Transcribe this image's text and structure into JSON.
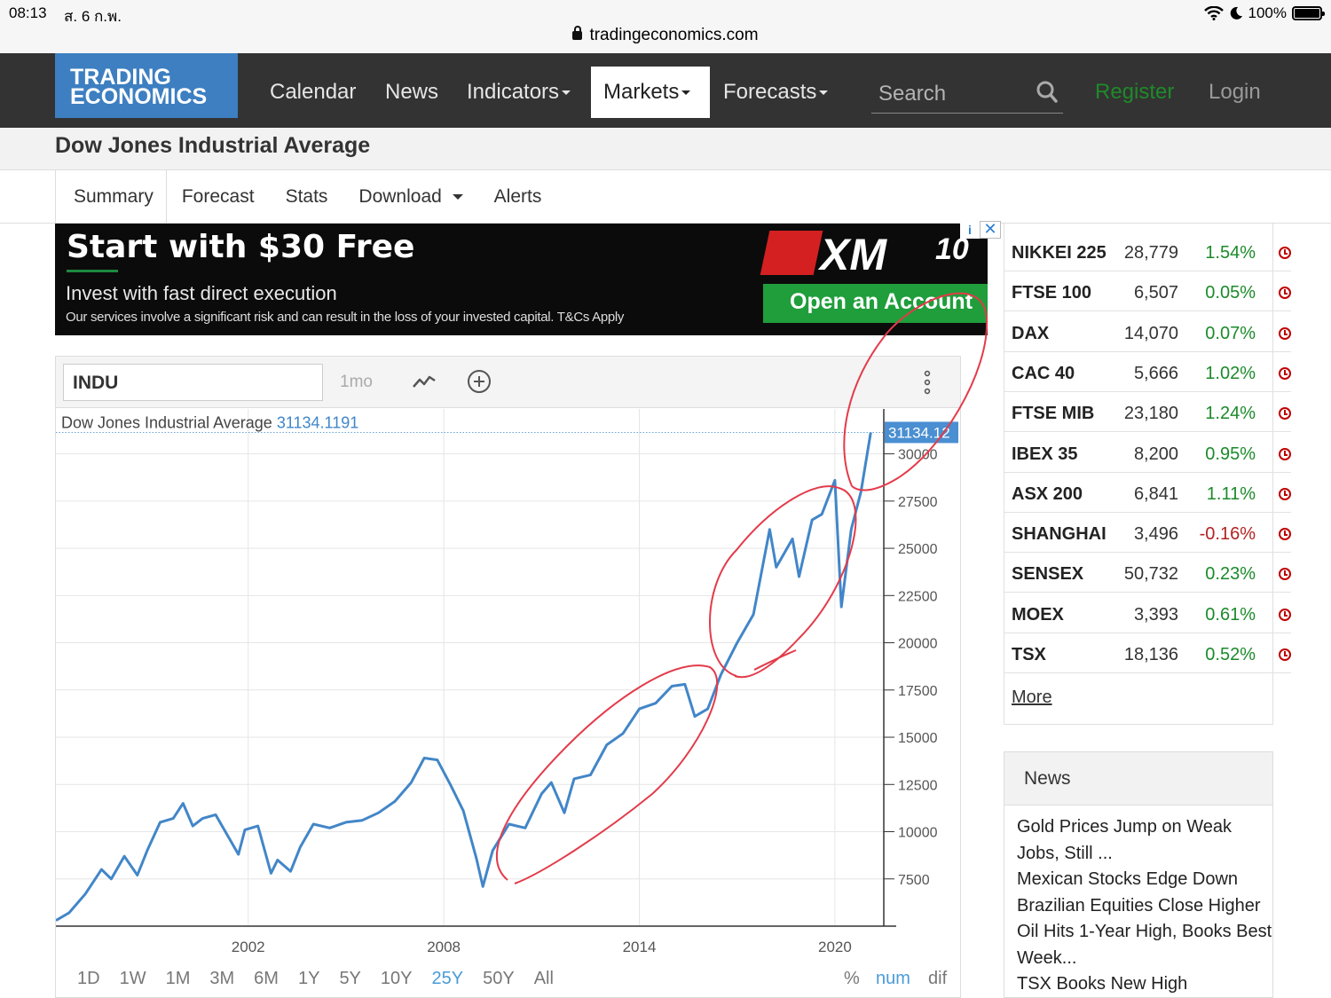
{
  "status": {
    "time": "08:13",
    "date": "ส. 6 ก.พ.",
    "battery": "100%",
    "url": "tradingeconomics.com"
  },
  "nav": {
    "logo_line1": "TRADING",
    "logo_line2": "ECONOMICS",
    "items": [
      "Calendar",
      "News",
      "Indicators",
      "Markets",
      "Forecasts"
    ],
    "search_placeholder": "Search",
    "register": "Register",
    "login": "Login",
    "register_color": "#1f8a2a",
    "bar_color": "#333333",
    "logo_color": "#3d7fc1"
  },
  "page": {
    "title": "Dow Jones Industrial Average"
  },
  "tabs": [
    "Summary",
    "Forecast",
    "Stats",
    "Download",
    "Alerts"
  ],
  "ad": {
    "headline": "Start with $30 Free",
    "subline": "Invest with fast direct execution",
    "fine_print": "Our services involve a significant risk and can result in the loss of your invested capital. T&Cs Apply",
    "brand": "XM",
    "anniversary": "10",
    "cta": "Open an Account"
  },
  "chart_panel": {
    "symbol": "INDU",
    "period": "1mo",
    "ranges": [
      "1D",
      "1W",
      "1M",
      "3M",
      "6M",
      "1Y",
      "5Y",
      "10Y",
      "25Y",
      "50Y",
      "All"
    ],
    "selected_range": "25Y",
    "modes": [
      "%",
      "num",
      "dif"
    ],
    "selected_mode": "num"
  },
  "chart_data": {
    "type": "line",
    "title": "Dow Jones Industrial Average",
    "last_value_label": "31134.1191",
    "last_value_tag": "31134.12",
    "series_color": "#4286c8",
    "ylim": [
      5000,
      32000
    ],
    "yticks": [
      7500,
      10000,
      12500,
      15000,
      17500,
      20000,
      22500,
      25000,
      27500,
      30000
    ],
    "xlim": [
      1996.1,
      2021.5
    ],
    "xticks": [
      2002,
      2008,
      2014,
      2020
    ],
    "grid": true,
    "x": [
      1996.1,
      1996.5,
      1997.0,
      1997.5,
      1997.8,
      1998.2,
      1998.6,
      1998.9,
      1999.3,
      1999.7,
      2000.0,
      2000.3,
      2000.6,
      2001.0,
      2001.3,
      2001.7,
      2001.9,
      2002.3,
      2002.7,
      2002.9,
      2003.3,
      2003.6,
      2004.0,
      2004.5,
      2005.0,
      2005.5,
      2006.0,
      2006.5,
      2007.0,
      2007.4,
      2007.8,
      2008.2,
      2008.6,
      2009.0,
      2009.2,
      2009.5,
      2010.0,
      2010.5,
      2011.0,
      2011.3,
      2011.7,
      2012.0,
      2012.5,
      2013.0,
      2013.5,
      2014.0,
      2014.5,
      2015.0,
      2015.4,
      2015.7,
      2016.1,
      2016.5,
      2017.0,
      2017.5,
      2018.0,
      2018.2,
      2018.7,
      2018.9,
      2019.3,
      2019.6,
      2020.0,
      2020.2,
      2020.5,
      2020.8,
      2021.1
    ],
    "y": [
      5300,
      5700,
      6700,
      8000,
      7500,
      8700,
      7700,
      9000,
      10500,
      10700,
      11500,
      10300,
      10700,
      10900,
      10000,
      8800,
      10100,
      10300,
      7800,
      8500,
      7900,
      9200,
      10400,
      10200,
      10500,
      10600,
      11000,
      11600,
      12600,
      13900,
      13800,
      12500,
      11100,
      8600,
      7100,
      9000,
      10400,
      10200,
      12000,
      12600,
      11000,
      12800,
      13000,
      14600,
      15200,
      16500,
      16800,
      17700,
      17800,
      16100,
      16500,
      18300,
      20000,
      21500,
      26000,
      24000,
      25500,
      23500,
      26500,
      26800,
      28600,
      21900,
      26000,
      28000,
      31134
    ]
  },
  "markets": [
    {
      "name": "NIKKEI 225",
      "value": "28,779",
      "change": "1.54%",
      "dir": "up"
    },
    {
      "name": "FTSE 100",
      "value": "6,507",
      "change": "0.05%",
      "dir": "up"
    },
    {
      "name": "DAX",
      "value": "14,070",
      "change": "0.07%",
      "dir": "up"
    },
    {
      "name": "CAC 40",
      "value": "5,666",
      "change": "1.02%",
      "dir": "up"
    },
    {
      "name": "FTSE MIB",
      "value": "23,180",
      "change": "1.24%",
      "dir": "up"
    },
    {
      "name": "IBEX 35",
      "value": "8,200",
      "change": "0.95%",
      "dir": "up"
    },
    {
      "name": "ASX 200",
      "value": "6,841",
      "change": "1.11%",
      "dir": "up"
    },
    {
      "name": "SHANGHAI",
      "value": "3,496",
      "change": "-0.16%",
      "dir": "down"
    },
    {
      "name": "SENSEX",
      "value": "50,732",
      "change": "0.23%",
      "dir": "up"
    },
    {
      "name": "MOEX",
      "value": "3,393",
      "change": "0.61%",
      "dir": "up"
    },
    {
      "name": "TSX",
      "value": "18,136",
      "change": "0.52%",
      "dir": "up"
    }
  ],
  "more_label": "More",
  "news": {
    "heading": "News",
    "items": [
      "Gold Prices Jump on Weak Jobs, Still ...",
      "Mexican Stocks Edge Down",
      "Brazilian Equities Close Higher",
      "Oil Hits 1-Year High, Books Best Week...",
      "TSX Books New High"
    ]
  }
}
